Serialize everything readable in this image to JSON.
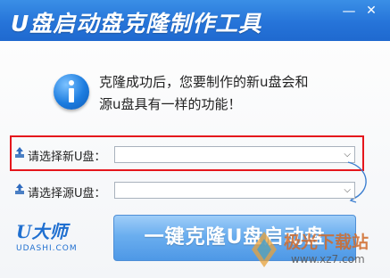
{
  "window": {
    "title": "U盘启动盘克隆制作工具",
    "minimize_glyph": "—",
    "close_glyph": "✕"
  },
  "message": {
    "line1": "克隆成功后，您要制作的新u盘会和",
    "line2": "源u盘具有一样的功能！",
    "icon": "info-icon"
  },
  "new_disk": {
    "label": "请选择新U盘：",
    "value": "",
    "icon": "usb-upload-icon"
  },
  "source_disk": {
    "label": "请选择源U盘：",
    "value": "",
    "icon": "usb-upload-icon"
  },
  "clone_button": {
    "label": "一键克隆U盘启动盘"
  },
  "brand": {
    "mark": "U大师",
    "text": "UDASHI.COM"
  },
  "watermark": {
    "title": "极光下载站",
    "url": "www.xz7.com"
  },
  "colors": {
    "titlebar": "#2674d9",
    "button": "#6aaeef",
    "highlight": "#e5161c",
    "brand": "#1f6fd0"
  }
}
